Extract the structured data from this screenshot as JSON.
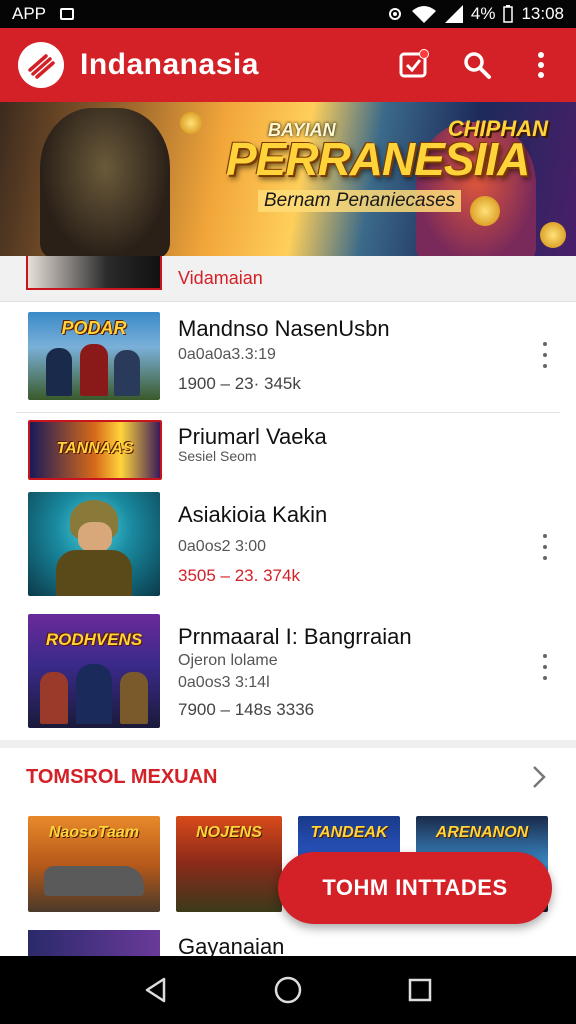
{
  "status_bar": {
    "left_label": "APP",
    "battery": "4%",
    "time": "13:08"
  },
  "app_bar": {
    "title": "Indananasia"
  },
  "banner": {
    "kicker": "BAYIAN",
    "title": "PERRANESIIA",
    "subtitle": "Bernam Penaniecases",
    "corner_text": "CHIPHAN"
  },
  "strip": {
    "label": "Vidamaian"
  },
  "list": [
    {
      "title": "Mandnso NasenUsbn",
      "sub": "0a0a0a3.3:19",
      "stats": "1900 – 23· 345k",
      "thumb_text": "PODAR"
    },
    {
      "title": "Priumarl Vaeka",
      "sub": "Sesiel Seom",
      "thumb_text": "TANNAAS"
    },
    {
      "title": "Asiakioia Kakin",
      "sub": "0a0os2 3:00",
      "stats": "3505 – 23. 374k"
    },
    {
      "title": "Prnmaaral I: Bangrraian",
      "sub": "Ojeron lolame",
      "sub2": "0a0os3 3:14l",
      "stats": "7900 – 148s 3336",
      "thumb_text": "RODHVENS"
    }
  ],
  "section": {
    "title": "TOMSROL MEXUAN"
  },
  "cards": [
    {
      "text": "NaosoTaam"
    },
    {
      "text": "NOJENS"
    },
    {
      "text": "TANDEAK"
    },
    {
      "text": "ARENANON"
    }
  ],
  "peek": {
    "title": "Gayanaian"
  },
  "fab": {
    "label": "TOHM INTTADES"
  }
}
